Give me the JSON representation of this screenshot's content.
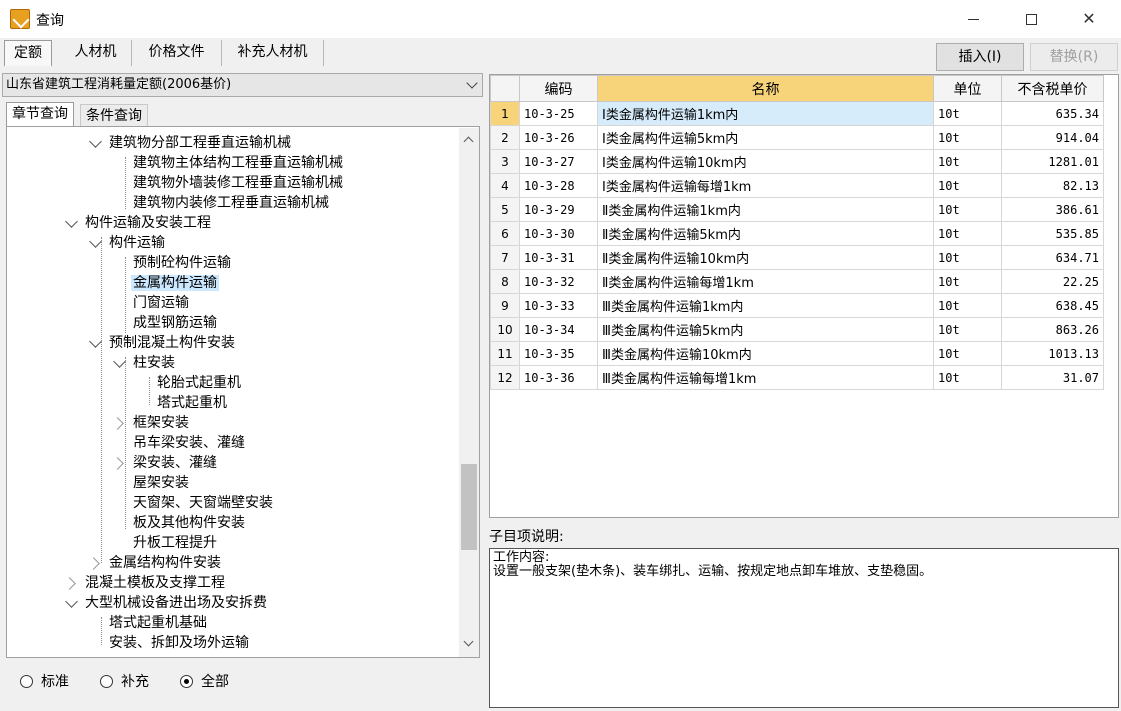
{
  "window": {
    "title": "查询"
  },
  "tabs": [
    {
      "label": "定额"
    },
    {
      "label": "人材机"
    },
    {
      "label": "价格文件"
    },
    {
      "label": "补充人材机"
    }
  ],
  "actions": {
    "insert_label": "插入(I)",
    "replace_label": "替换(R)"
  },
  "library": {
    "selected": "山东省建筑工程消耗量定额(2006基价)"
  },
  "subtabs": [
    {
      "label": "章节查询"
    },
    {
      "label": "条件查询"
    }
  ],
  "tree": [
    {
      "label": "建筑物分部工程垂直运输机械"
    },
    {
      "label": "建筑物主体结构工程垂直运输机械"
    },
    {
      "label": "建筑物外墙装修工程垂直运输机械"
    },
    {
      "label": "建筑物内装修工程垂直运输机械"
    },
    {
      "label": "构件运输及安装工程"
    },
    {
      "label": "构件运输"
    },
    {
      "label": "预制砼构件运输"
    },
    {
      "label": "金属构件运输"
    },
    {
      "label": "门窗运输"
    },
    {
      "label": "成型钢筋运输"
    },
    {
      "label": "预制混凝土构件安装"
    },
    {
      "label": "柱安装"
    },
    {
      "label": "轮胎式起重机"
    },
    {
      "label": "塔式起重机"
    },
    {
      "label": "框架安装"
    },
    {
      "label": "吊车梁安装、灌缝"
    },
    {
      "label": "梁安装、灌缝"
    },
    {
      "label": "屋架安装"
    },
    {
      "label": "天窗架、天窗端壁安装"
    },
    {
      "label": "板及其他构件安装"
    },
    {
      "label": "升板工程提升"
    },
    {
      "label": "金属结构构件安装"
    },
    {
      "label": "混凝土模板及支撑工程"
    },
    {
      "label": "大型机械设备进出场及安拆费"
    },
    {
      "label": "塔式起重机基础"
    },
    {
      "label": "安装、拆卸及场外运输"
    }
  ],
  "filter": [
    {
      "label": "标准"
    },
    {
      "label": "补充"
    },
    {
      "label": "全部"
    }
  ],
  "grid": {
    "headers": {
      "code": "编码",
      "name": "名称",
      "unit": "单位",
      "price": "不含税单价"
    },
    "rows": [
      {
        "n": "1",
        "code": "10-3-25",
        "name": "Ⅰ类金属构件运输1km内",
        "unit": "10t",
        "price": "635.34"
      },
      {
        "n": "2",
        "code": "10-3-26",
        "name": "Ⅰ类金属构件运输5km内",
        "unit": "10t",
        "price": "914.04"
      },
      {
        "n": "3",
        "code": "10-3-27",
        "name": "Ⅰ类金属构件运输10km内",
        "unit": "10t",
        "price": "1281.01"
      },
      {
        "n": "4",
        "code": "10-3-28",
        "name": "Ⅰ类金属构件运输每增1km",
        "unit": "10t",
        "price": "82.13"
      },
      {
        "n": "5",
        "code": "10-3-29",
        "name": "Ⅱ类金属构件运输1km内",
        "unit": "10t",
        "price": "386.61"
      },
      {
        "n": "6",
        "code": "10-3-30",
        "name": "Ⅱ类金属构件运输5km内",
        "unit": "10t",
        "price": "535.85"
      },
      {
        "n": "7",
        "code": "10-3-31",
        "name": "Ⅱ类金属构件运输10km内",
        "unit": "10t",
        "price": "634.71"
      },
      {
        "n": "8",
        "code": "10-3-32",
        "name": "Ⅱ类金属构件运输每增1km",
        "unit": "10t",
        "price": "22.25"
      },
      {
        "n": "9",
        "code": "10-3-33",
        "name": "Ⅲ类金属构件运输1km内",
        "unit": "10t",
        "price": "638.45"
      },
      {
        "n": "10",
        "code": "10-3-34",
        "name": "Ⅲ类金属构件运输5km内",
        "unit": "10t",
        "price": "863.26"
      },
      {
        "n": "11",
        "code": "10-3-35",
        "name": "Ⅲ类金属构件运输10km内",
        "unit": "10t",
        "price": "1013.13"
      },
      {
        "n": "12",
        "code": "10-3-36",
        "name": "Ⅲ类金属构件运输每增1km",
        "unit": "10t",
        "price": "31.07"
      }
    ]
  },
  "description": {
    "label": "子目项说明:",
    "heading": "工作内容:",
    "text": "设置一般支架(垫木条)、装车绑扎、运输、按规定地点卸车堆放、支垫稳固。"
  }
}
